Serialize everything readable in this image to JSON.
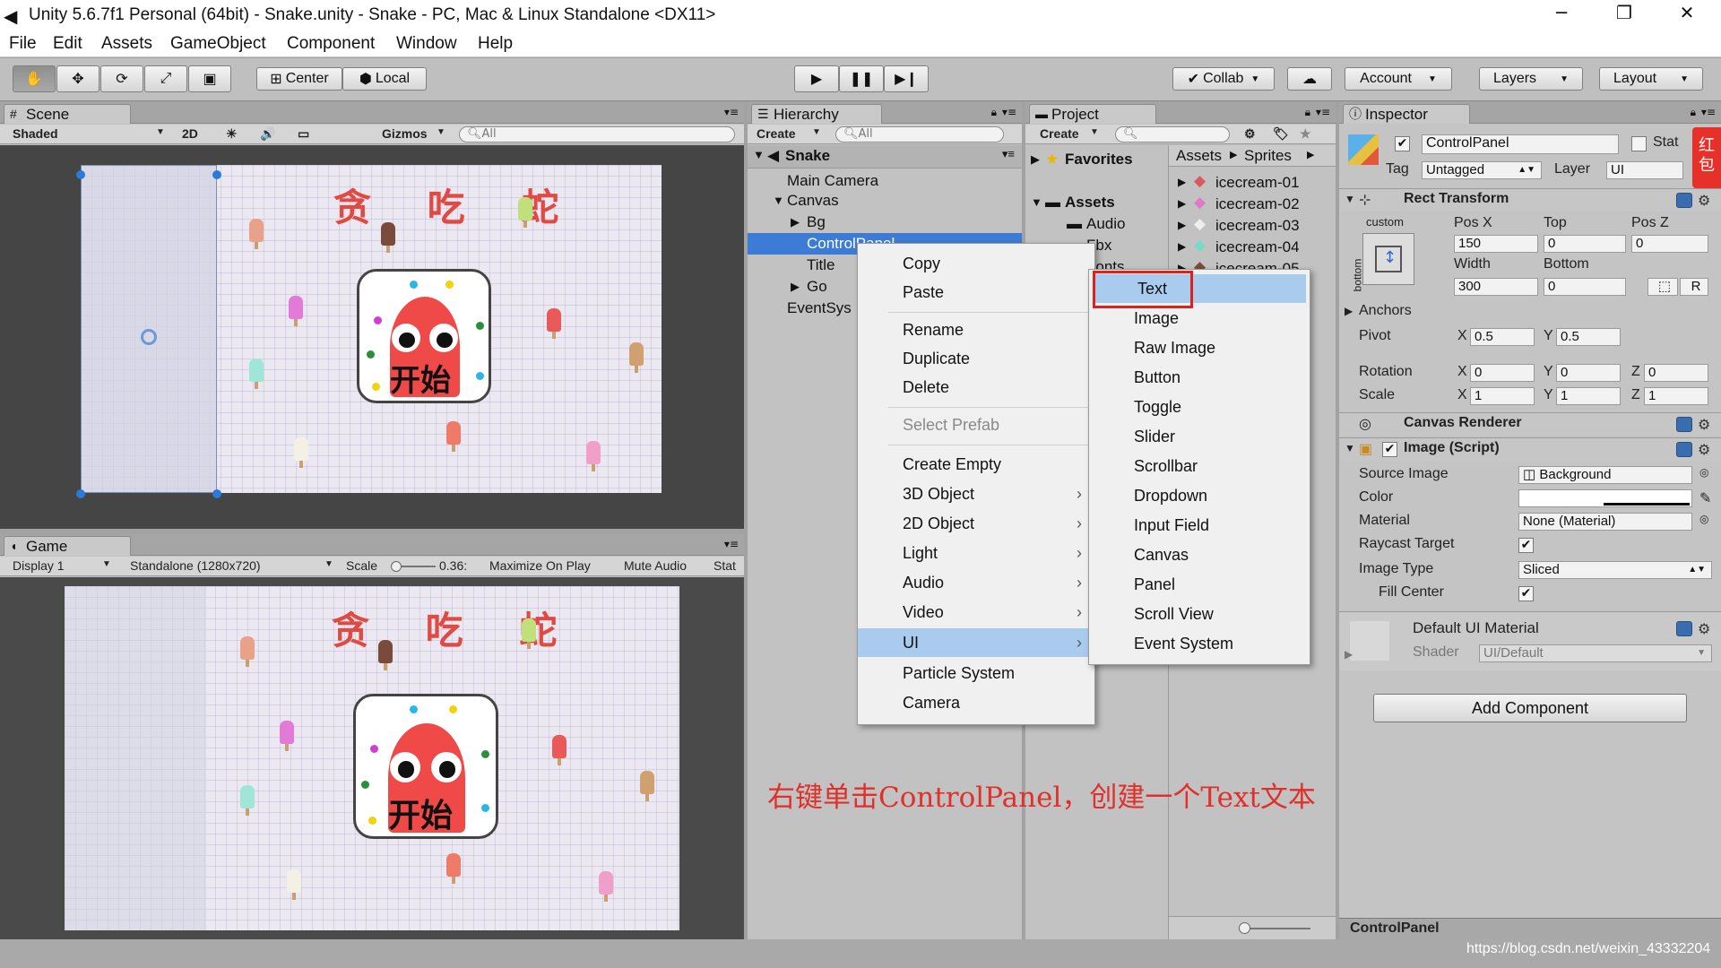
{
  "window": {
    "title": "Unity 5.6.7f1 Personal (64bit) - Snake.unity - Snake - PC, Mac & Linux Standalone <DX11>",
    "minimize": "─",
    "restore": "❐",
    "close": "✕"
  },
  "menu": [
    "File",
    "Edit",
    "Assets",
    "GameObject",
    "Component",
    "Window",
    "Help"
  ],
  "toolbar": {
    "center": "Center",
    "local": "Local",
    "collab": "Collab",
    "account": "Account",
    "layers": "Layers",
    "layout": "Layout"
  },
  "scene": {
    "tab": "Scene",
    "shading": "Shaded",
    "mode2d": "2D",
    "gizmos": "Gizmos",
    "search": "All"
  },
  "game": {
    "tab": "Game",
    "display": "Display 1",
    "resolution": "Standalone (1280x720)",
    "scale_label": "Scale",
    "scale_value": "0.36:",
    "maximize": "Maximize On Play",
    "mute": "Mute Audio",
    "stats": "Stat"
  },
  "canvas_art": {
    "title": "贪 吃 蛇",
    "start": "开始",
    "title_color": "#e04a42",
    "button_color": "#f04a48"
  },
  "hierarchy": {
    "tab": "Hierarchy",
    "create": "Create",
    "search": "All",
    "items": [
      "Snake",
      "Main Camera",
      "Canvas",
      "Bg",
      "ControlPanel",
      "Title",
      "Go",
      "EventSys"
    ]
  },
  "project": {
    "tab": "Project",
    "create": "Create",
    "favorites": "Favorites",
    "assets": "Assets",
    "folders": [
      "Audio",
      "Fbx",
      "Fonts"
    ],
    "breadcrumb": [
      "Assets",
      "Sprites"
    ],
    "sprites": [
      "icecream-01",
      "icecream-02",
      "icecream-03",
      "icecream-04",
      "icecream-05"
    ]
  },
  "context_menu": {
    "items": [
      "Copy",
      "Paste",
      "Rename",
      "Duplicate",
      "Delete",
      "Select Prefab",
      "Create Empty",
      "3D Object",
      "2D Object",
      "Light",
      "Audio",
      "Video",
      "UI",
      "Particle System",
      "Camera"
    ]
  },
  "ui_submenu": {
    "items": [
      "Text",
      "Image",
      "Raw Image",
      "Button",
      "Toggle",
      "Slider",
      "Scrollbar",
      "Dropdown",
      "Input Field",
      "Canvas",
      "Panel",
      "Scroll View",
      "Event System"
    ]
  },
  "inspector": {
    "tab": "Inspector",
    "object_name": "ControlPanel",
    "static": "Stat",
    "tag_label": "Tag",
    "tag": "Untagged",
    "layer_label": "Layer",
    "layer": "UI",
    "rect": {
      "title": "Rect Transform",
      "custom": "custom",
      "bottom": "bottom",
      "posx_label": "Pos X",
      "top_label": "Top",
      "posz_label": "Pos Z",
      "posx": "150",
      "top": "0",
      "posz": "0",
      "width_label": "Width",
      "bottom_label": "Bottom",
      "width": "300",
      "bottom_val": "0",
      "r": "R",
      "anchors": "Anchors",
      "pivot": "Pivot",
      "pivot_x": "0.5",
      "pivot_y": "0.5",
      "rotation": "Rotation",
      "rot_x": "0",
      "rot_y": "0",
      "rot_z": "0",
      "scale": "Scale",
      "scale_x": "1",
      "scale_y": "1",
      "scale_z": "1",
      "x": "X",
      "y": "Y",
      "z": "Z"
    },
    "canvas_renderer": "Canvas Renderer",
    "image": {
      "title": "Image (Script)",
      "source_label": "Source Image",
      "source": "Background",
      "color_label": "Color",
      "material_label": "Material",
      "material": "None (Material)",
      "raycast_label": "Raycast Target",
      "type_label": "Image Type",
      "type": "Sliced",
      "fill_label": "Fill Center"
    },
    "material": {
      "title": "Default UI Material",
      "shader_label": "Shader",
      "shader": "UI/Default"
    },
    "add_component": "Add Component",
    "footer": "ControlPanel"
  },
  "annotation": "右键单击ControlPanel，创建一个Text文本",
  "watermark": "https://blog.csdn.net/weixin_43332204",
  "side_badge": "红包"
}
